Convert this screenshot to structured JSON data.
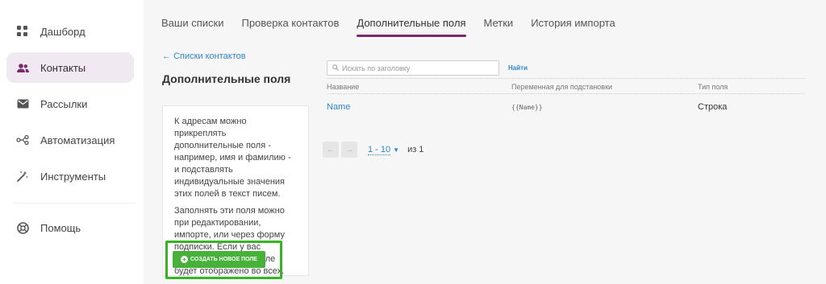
{
  "sidebar": {
    "items": [
      {
        "label": "Дашборд",
        "icon": "dashboard-icon"
      },
      {
        "label": "Контакты",
        "icon": "contacts-icon",
        "active": true
      },
      {
        "label": "Рассылки",
        "icon": "mail-icon"
      },
      {
        "label": "Автоматизация",
        "icon": "automation-icon"
      },
      {
        "label": "Инструменты",
        "icon": "magic-wand-icon"
      },
      {
        "label": "Помощь",
        "icon": "help-icon"
      }
    ]
  },
  "tabs": [
    {
      "label": "Ваши списки"
    },
    {
      "label": "Проверка контактов"
    },
    {
      "label": "Дополнительные поля",
      "active": true
    },
    {
      "label": "Метки"
    },
    {
      "label": "История импорта"
    }
  ],
  "back_link": "← Списки контактов",
  "page_title": "Дополнительные поля",
  "info": {
    "p1": "К адресам можно прикреплять дополнительные поля - например, имя и фамилию - и подставлять индивидуальные значения этих полей в текст писем.",
    "p2": "Заполнять эти поля можно при редактировании, импорте, или через форму подписки. Если у вас несколько списков, поле будет отображено во всех."
  },
  "create_button": "создать новое поле",
  "search": {
    "placeholder": "Искать по заголовку",
    "button": "Найти"
  },
  "table": {
    "headers": [
      "Название",
      "Переменная для подстановки",
      "Тип поля"
    ],
    "rows": [
      {
        "name": "Name",
        "variable": "{{Name}}",
        "type": "Строка"
      }
    ]
  },
  "pager": {
    "range": "1 - 10",
    "total": "из 1"
  },
  "colors": {
    "accent": "#7a2a6a",
    "link": "#2f86c9",
    "button": "#46b23a",
    "highlight": "#36b524",
    "active_nav_bg": "#f1e9f1"
  }
}
